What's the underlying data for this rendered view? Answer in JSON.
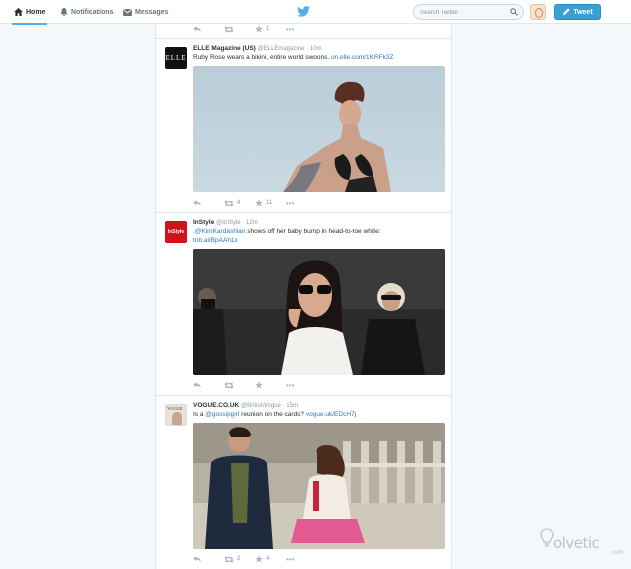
{
  "nav": {
    "home": "Home",
    "notifications": "Notifications",
    "messages": "Messages",
    "search_placeholder": "Search Twitter",
    "tweet_button": "Tweet"
  },
  "top_actions": {
    "favorites": "1"
  },
  "tweets": [
    {
      "avatar_text": "ELLE",
      "name": "ELLE Magazine (US)",
      "handle": "@ELLEmagazine",
      "time": "· 10m",
      "text": "Ruby Rose wears a bikini, entire world swoons.",
      "link": "on.elle.com/1KRFk3Z",
      "retweets": "4",
      "favorites": "11"
    },
    {
      "avatar_text": "InStyle",
      "name": "InStyle",
      "handle": "@InStyle",
      "time": "· 12m",
      "mention": ".@KimKardashian",
      "text": "shows off her baby bump in head-to-toe white:",
      "link": "trib.al/BpAAh1x",
      "retweets": "",
      "favorites": ""
    },
    {
      "avatar_text": "VOGUE",
      "name": "VOGUE.CO.UK",
      "handle": "@BritishVogue",
      "time": "· 15m",
      "text_pre": "Is a",
      "mention": "@gossipgirl",
      "text": "reunion on the cards?",
      "link": "vogue.uk/EDcH7j",
      "retweets": "2",
      "favorites": "4"
    }
  ],
  "watermark": "olvetic",
  "watermark_domain": ".com",
  "colors": {
    "accent": "#55acee",
    "link": "#2b7bb9",
    "tweet_button": "#3aa0d4"
  }
}
